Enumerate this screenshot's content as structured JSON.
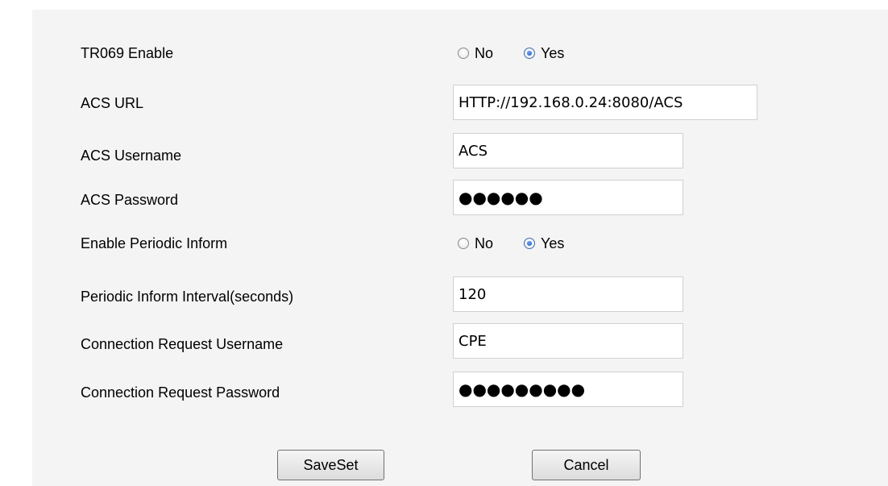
{
  "tr069_enable": {
    "label": "TR069 Enable",
    "options": [
      {
        "label": "No",
        "checked": false
      },
      {
        "label": "Yes",
        "checked": true
      }
    ]
  },
  "acs_url": {
    "label": "ACS URL",
    "value": "HTTP://192.168.0.24:8080/ACS"
  },
  "acs_username": {
    "label": "ACS Username",
    "value": "ACS"
  },
  "acs_password": {
    "label": "ACS Password",
    "value": "●●●●●●"
  },
  "periodic_inform": {
    "label": "Enable Periodic Inform",
    "options": [
      {
        "label": "No",
        "checked": false
      },
      {
        "label": "Yes",
        "checked": true
      }
    ]
  },
  "periodic_interval": {
    "label": "Periodic Inform Interval(seconds)",
    "value": "120"
  },
  "conn_req_username": {
    "label": "Connection Request Username",
    "value": "CPE"
  },
  "conn_req_password": {
    "label": "Connection Request Password",
    "value": "●●●●●●●●●"
  },
  "buttons": {
    "save": "SaveSet",
    "cancel": "Cancel"
  },
  "colors": {
    "panel_background": "#f4f4f4",
    "radio_checked": "#1e4fa8"
  }
}
